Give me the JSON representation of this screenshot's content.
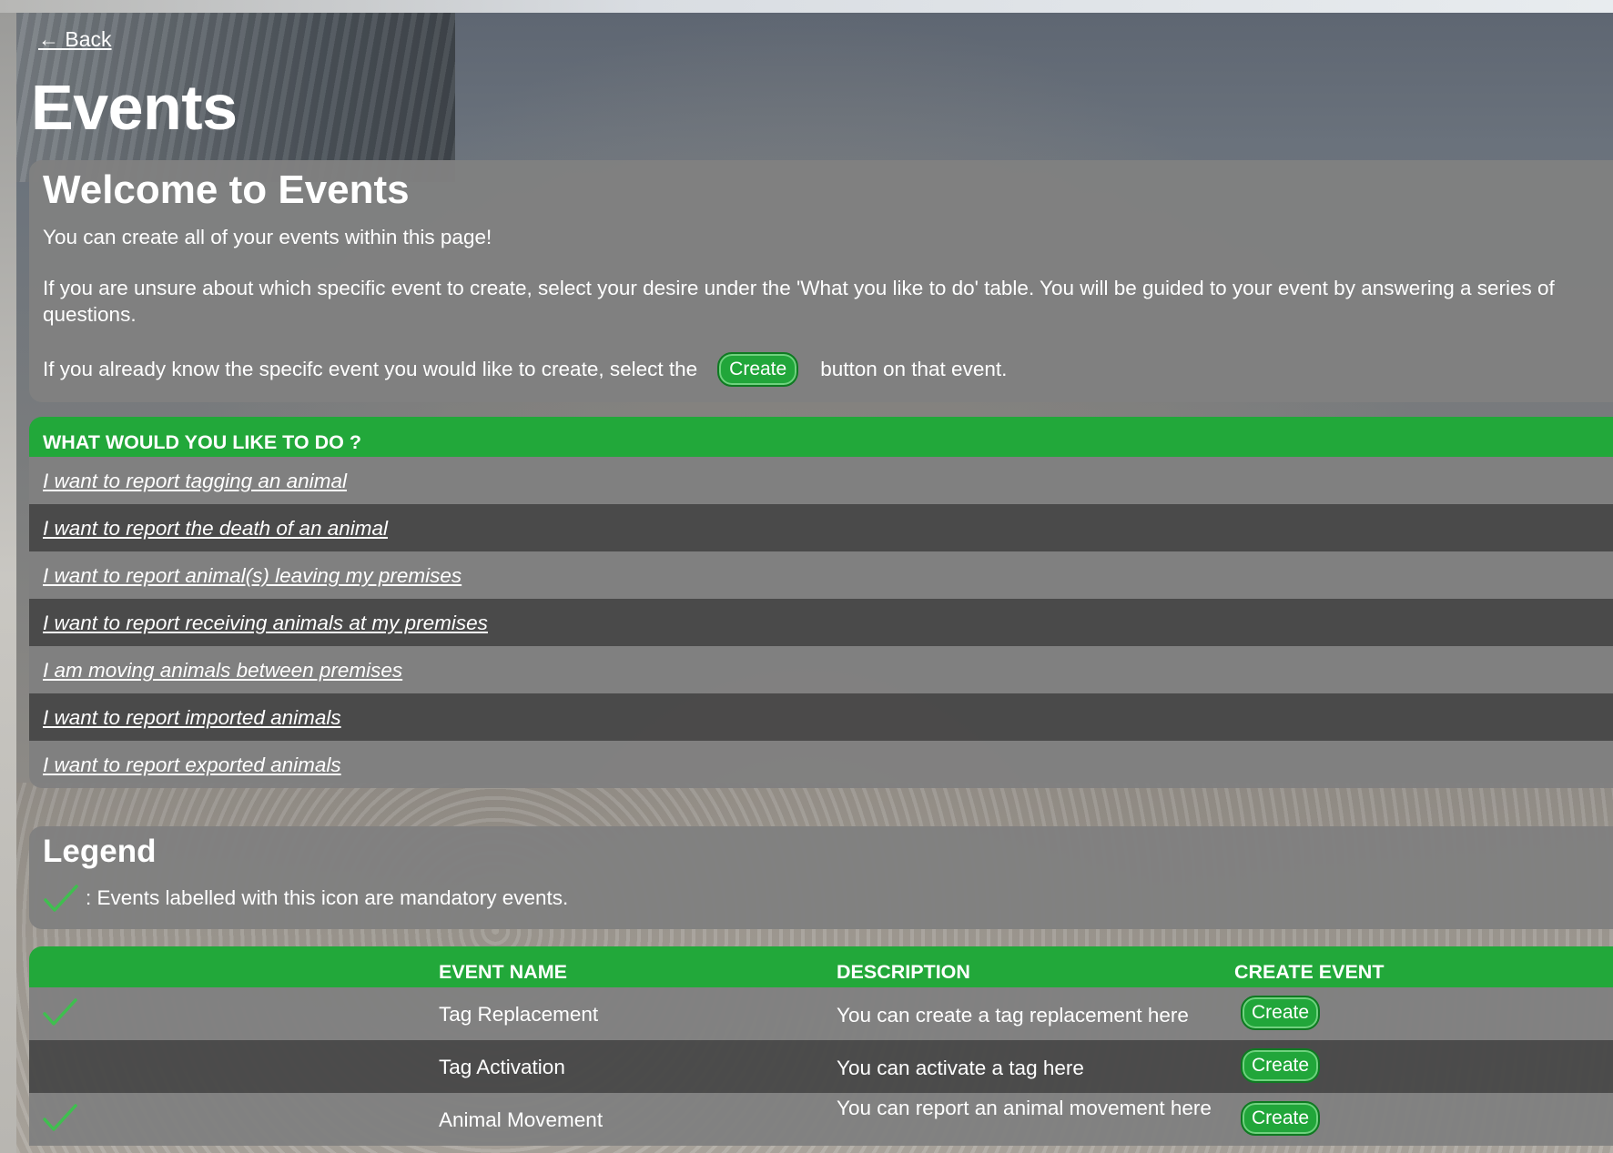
{
  "nav": {
    "back_label": "← Back"
  },
  "page": {
    "title": "Events"
  },
  "welcome": {
    "heading": "Welcome to Events",
    "para1": "You can create all of your events within this page!",
    "para2": "If you are unsure about which specific event to create, select your desire under the 'What you like to do' table. You will be guided to your event by answering a series of questions.",
    "para3_before": "If you already know the specifc event you would like to create, select the",
    "para3_button": "Create",
    "para3_after": "button on that event."
  },
  "what_to_do": {
    "header": "WHAT WOULD YOU LIKE TO DO ?",
    "items": [
      "I want to report tagging an animal",
      "I want to report the death of an animal",
      "I want to report animal(s) leaving my premises",
      "I want to report receiving animals at my premises",
      "I am moving animals between premises",
      "I want to report imported animals",
      "I want to report exported animals"
    ]
  },
  "legend": {
    "heading": "Legend",
    "icon": "checkmark-icon",
    "text": ": Events labelled with this icon are mandatory events."
  },
  "events_table": {
    "columns": [
      "",
      "EVENT NAME",
      "DESCRIPTION",
      "CREATE EVENT"
    ],
    "rows": [
      {
        "mandatory": true,
        "name": "Tag Replacement",
        "description": "You can create a tag replacement here",
        "button": "Create"
      },
      {
        "mandatory": false,
        "name": "Tag Activation",
        "description": "You can activate a tag here",
        "button": "Create"
      },
      {
        "mandatory": true,
        "name": "Animal Movement",
        "description": "You can report an animal movement here",
        "button": "Create"
      }
    ]
  },
  "colors": {
    "accent_green": "#22a83a",
    "card_gray": "#808080",
    "row_dark": "#484848",
    "check_green": "#3fbf4f"
  }
}
